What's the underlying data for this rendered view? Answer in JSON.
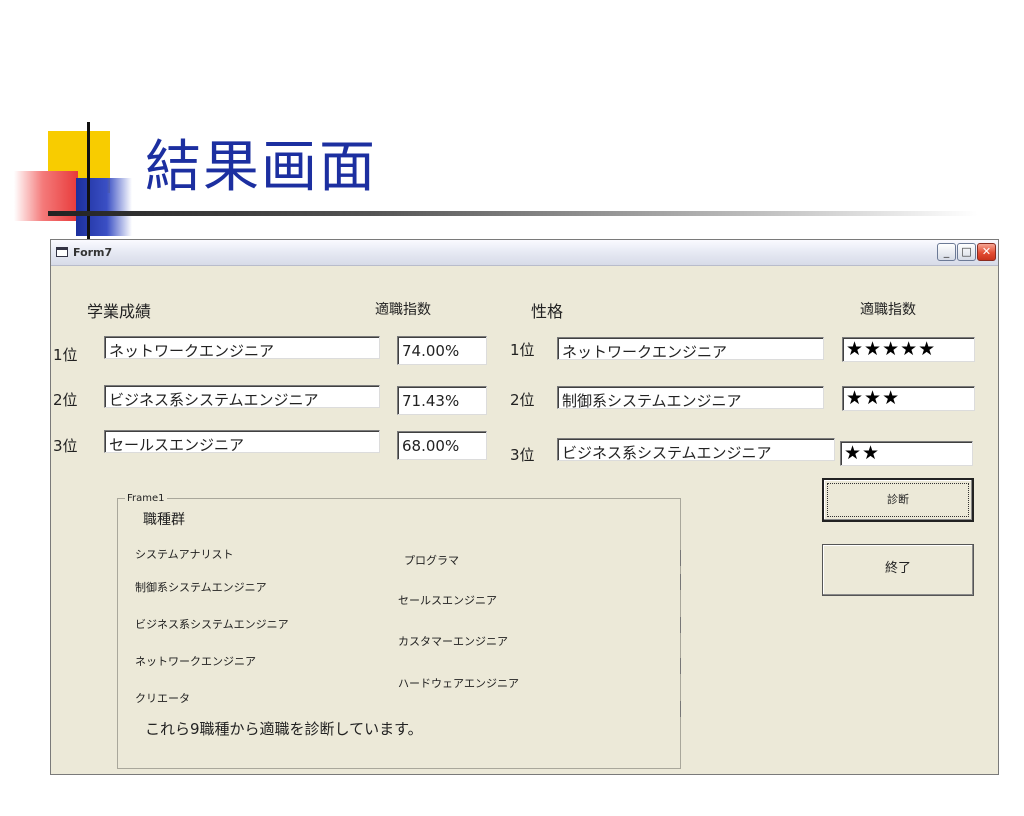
{
  "slide": {
    "title": "結果画面"
  },
  "window": {
    "title": "Form7",
    "controls": {
      "minimize": "_",
      "maximize": "□",
      "close": "✕"
    }
  },
  "academic": {
    "heading": "学業成績",
    "score_heading": "適職指数",
    "ranks": [
      {
        "rank": "1位",
        "job": "ネットワークエンジニア",
        "score": "74.00%"
      },
      {
        "rank": "2位",
        "job": "ビジネス系システムエンジニア",
        "score": "71.43%"
      },
      {
        "rank": "3位",
        "job": "セールスエンジニア",
        "score": "68.00%"
      }
    ]
  },
  "personality": {
    "heading": "性格",
    "score_heading": "適職指数",
    "ranks": [
      {
        "rank": "1位",
        "job": "ネットワークエンジニア",
        "stars": "★★★★★",
        "star_count": 5
      },
      {
        "rank": "2位",
        "job": "制御系システムエンジニア",
        "stars": "★★★",
        "star_count": 3
      },
      {
        "rank": "3位",
        "job": "ビジネス系システムエンジニア",
        "stars": "★★",
        "star_count": 2
      }
    ]
  },
  "buttons": {
    "diagnose": "診断",
    "exit": "終了"
  },
  "frame": {
    "caption": "Frame1",
    "title": "職種群",
    "left_jobs": [
      "システムアナリスト",
      "制御系システムエンジニア",
      "ビジネス系システムエンジニア",
      "ネットワークエンジニア",
      "クリエータ"
    ],
    "right_jobs": [
      "プログラマ",
      "セールスエンジニア",
      "カスタマーエンジニア",
      "ハードウェアエンジニア"
    ],
    "note": "これら9職種から適職を診断しています。"
  },
  "icons": {
    "app": "form-window-icon"
  }
}
